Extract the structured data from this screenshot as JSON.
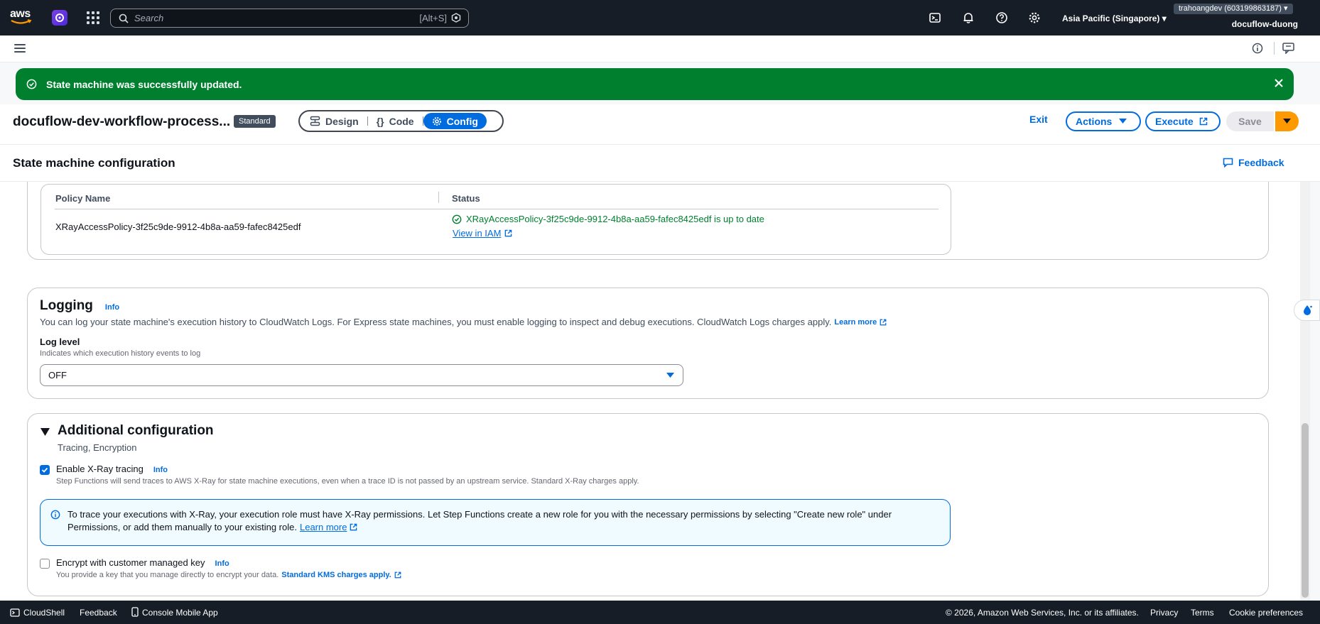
{
  "topnav": {
    "logo_text": "aws",
    "search_placeholder": "Search",
    "search_shortcut": "[Alt+S]",
    "region": "Asia Pacific (Singapore) ▾",
    "account": "trahoangdev (603199863187) ▾",
    "user": "docuflow-duong"
  },
  "flash": {
    "message": "State machine was successfully updated."
  },
  "header": {
    "title": "docuflow-dev-workflow-process...",
    "badge": "Standard",
    "tabs": [
      "Design",
      "Code",
      "Config"
    ],
    "exit_label": "Exit",
    "actions_label": "Actions",
    "execute_label": "Execute",
    "save_label": "Save"
  },
  "config": {
    "title": "State machine configuration",
    "feedback_label": "Feedback"
  },
  "policies": {
    "col_name": "Policy Name",
    "col_status": "Status",
    "row": {
      "name": "XRayAccessPolicy-3f25c9de-9912-4b8a-aa59-fafec8425edf",
      "status": "XRayAccessPolicy-3f25c9de-9912-4b8a-aa59-fafec8425edf is up to date",
      "link": "View in IAM"
    }
  },
  "logging": {
    "title": "Logging",
    "info": "Info",
    "description": "You can log your state machine's execution history to CloudWatch Logs. For Express state machines, you must enable logging to inspect and debug executions. CloudWatch Logs charges apply.",
    "learn_more": "Learn more",
    "level_label": "Log level",
    "level_desc": "Indicates which execution history events to log",
    "level_value": "OFF"
  },
  "additional": {
    "title": "Additional configuration",
    "subtitle": "Tracing, Encryption",
    "xray_label": "Enable X-Ray tracing",
    "xray_info": "Info",
    "xray_checked": true,
    "xray_desc": "Step Functions will send traces to AWS X-Ray for state machine executions, even when a trace ID is not passed by an upstream service. Standard X-Ray charges apply.",
    "alert_line1": "To trace your executions with X-Ray, your execution role must have X-Ray permissions. Let Step Functions create a new role for you with the necessary permissions by selecting \"Create new role\" under",
    "alert_line2": "Permissions, or add them manually to your existing role.",
    "alert_link": "Learn more",
    "kms_label": "Encrypt with customer managed key",
    "kms_info": "Info",
    "kms_checked": false,
    "kms_desc": "You provide a key that you manage directly to encrypt your data.",
    "kms_link": "Standard KMS charges apply."
  },
  "footer": {
    "cloudshell": "CloudShell",
    "feedback": "Feedback",
    "mobile_app": "Console Mobile App",
    "copyright": "© 2026, Amazon Web Services, Inc. or its affiliates.",
    "privacy": "Privacy",
    "terms": "Terms",
    "cookies": "Cookie preferences"
  },
  "colors": {
    "success": "#00802f",
    "link": "#006ce0",
    "primary_orange": "#ff9900",
    "nav_bg": "#161d26"
  }
}
